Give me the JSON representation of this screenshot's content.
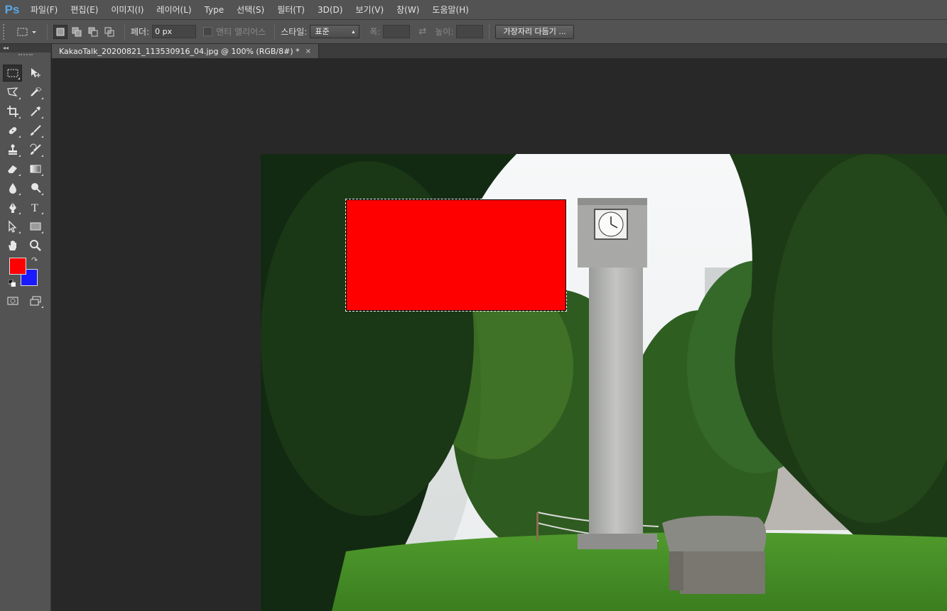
{
  "app": {
    "logo": "Ps"
  },
  "menu": [
    "파일(F)",
    "편집(E)",
    "이미지(I)",
    "레이어(L)",
    "Type",
    "선택(S)",
    "필터(T)",
    "3D(D)",
    "보기(V)",
    "창(W)",
    "도움말(H)"
  ],
  "options": {
    "feather_label": "페더:",
    "feather_value": "0 px",
    "antialias_label": "앤티 앨리어스",
    "style_label": "스타일:",
    "style_value": "표준",
    "width_label": "폭:",
    "height_label": "높이:",
    "refine_edge_label": "가장자리 다듬기 ..."
  },
  "document": {
    "tab_title": "KakaoTalk_20200821_113530916_04.jpg @ 100% (RGB/8#) *",
    "close_glyph": "×"
  },
  "colors": {
    "foreground": "#ff0000",
    "background": "#1a1aff",
    "selection_fill": "#ff0000"
  },
  "tools": [
    [
      "rectangular-marquee-icon",
      "move-icon"
    ],
    [
      "polygonal-lasso-icon",
      "quick-selection-icon"
    ],
    [
      "crop-icon",
      "eyedropper-icon"
    ],
    [
      "spot-healing-brush-icon",
      "brush-icon"
    ],
    [
      "clone-stamp-icon",
      "history-brush-icon"
    ],
    [
      "eraser-icon",
      "gradient-icon"
    ],
    [
      "blur-icon",
      "dodge-icon"
    ],
    [
      "pen-icon",
      "type-icon"
    ],
    [
      "path-selection-icon",
      "rectangle-shape-icon"
    ],
    [
      "hand-icon",
      "zoom-icon"
    ]
  ]
}
